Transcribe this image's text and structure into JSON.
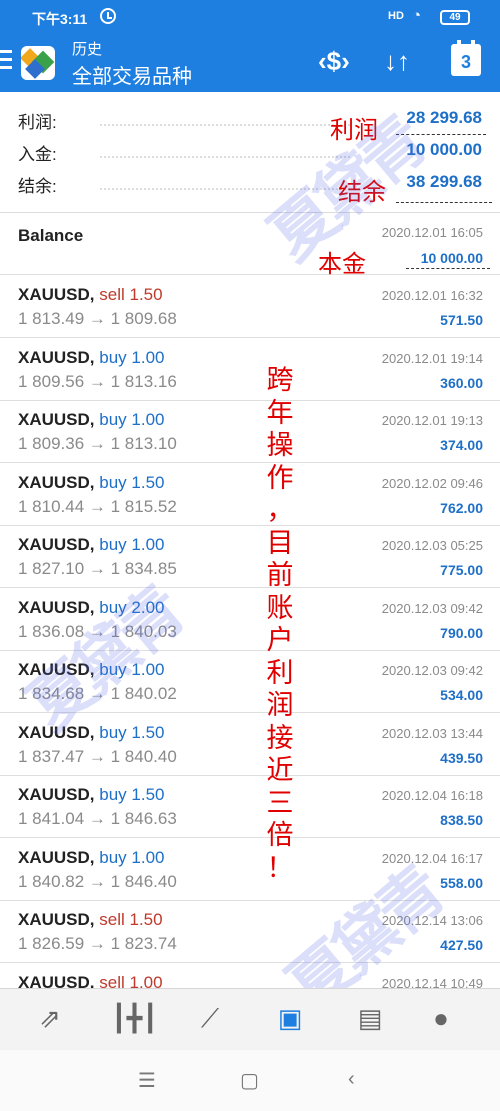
{
  "status_bar": {
    "time": "下午3:11",
    "signal": "HD",
    "battery": "49"
  },
  "header": {
    "title": "历史",
    "subtitle": "全部交易品种",
    "calendar_day": "3"
  },
  "summary": [
    {
      "label": "利润:",
      "value": "28 299.68"
    },
    {
      "label": "入金:",
      "value": "10 000.00"
    },
    {
      "label": "结余:",
      "value": "38 299.68"
    }
  ],
  "balance": {
    "label": "Balance",
    "time": "2020.12.01 16:05",
    "value": "10 000.00"
  },
  "trades": [
    {
      "symbol": "XAUUSD,",
      "direction": "sell",
      "lots": "1.50",
      "prices": "1 813.49 → 1 809.68",
      "time": "2020.12.01 16:32",
      "profit": "571.50"
    },
    {
      "symbol": "XAUUSD,",
      "direction": "buy",
      "lots": "1.00",
      "prices": "1 809.56 → 1 813.16",
      "time": "2020.12.01 19:14",
      "profit": "360.00"
    },
    {
      "symbol": "XAUUSD,",
      "direction": "buy",
      "lots": "1.00",
      "prices": "1 809.36 → 1 813.10",
      "time": "2020.12.01 19:13",
      "profit": "374.00"
    },
    {
      "symbol": "XAUUSD,",
      "direction": "buy",
      "lots": "1.50",
      "prices": "1 810.44 → 1 815.52",
      "time": "2020.12.02 09:46",
      "profit": "762.00"
    },
    {
      "symbol": "XAUUSD,",
      "direction": "buy",
      "lots": "1.00",
      "prices": "1 827.10 → 1 834.85",
      "time": "2020.12.03 05:25",
      "profit": "775.00"
    },
    {
      "symbol": "XAUUSD,",
      "direction": "buy",
      "lots": "2.00",
      "prices": "1 836.08 → 1 840.03",
      "time": "2020.12.03 09:42",
      "profit": "790.00"
    },
    {
      "symbol": "XAUUSD,",
      "direction": "buy",
      "lots": "1.00",
      "prices": "1 834.68 → 1 840.02",
      "time": "2020.12.03 09:42",
      "profit": "534.00"
    },
    {
      "symbol": "XAUUSD,",
      "direction": "buy",
      "lots": "1.50",
      "prices": "1 837.47 → 1 840.40",
      "time": "2020.12.03 13:44",
      "profit": "439.50"
    },
    {
      "symbol": "XAUUSD,",
      "direction": "buy",
      "lots": "1.50",
      "prices": "1 841.04 → 1 846.63",
      "time": "2020.12.04 16:18",
      "profit": "838.50"
    },
    {
      "symbol": "XAUUSD,",
      "direction": "buy",
      "lots": "1.00",
      "prices": "1 840.82 → 1 846.40",
      "time": "2020.12.04 16:17",
      "profit": "558.00"
    },
    {
      "symbol": "XAUUSD,",
      "direction": "sell",
      "lots": "1.50",
      "prices": "1 826.59 → 1 823.74",
      "time": "2020.12.14 13:06",
      "profit": "427.50"
    },
    {
      "symbol": "XAUUSD,",
      "direction": "sell",
      "lots": "1.00",
      "prices": "",
      "time": "2020.12.14 10:49",
      "profit": ""
    }
  ],
  "annotations": {
    "profit": "利润",
    "balance": "结余",
    "principal": "本金",
    "principal_value": "10 000.00",
    "vertical_text": [
      "跨",
      "年",
      "操",
      "作",
      "，",
      "目",
      "前",
      "账",
      "户",
      "利",
      "润",
      "接",
      "近",
      "三",
      "倍",
      "！"
    ]
  },
  "watermark": "夏黛青",
  "colors": {
    "header": "#1e7fe0",
    "sell": "#c0392b",
    "buy": "#1e6fc8",
    "annotation": "#e00000"
  },
  "bottom_nav": [
    "trade-icon",
    "chart-icon",
    "history-icon",
    "mailbox-icon",
    "news-icon",
    "chat-icon"
  ],
  "system_nav": {
    "menu": "☰",
    "home": "▢",
    "back": "‹"
  }
}
